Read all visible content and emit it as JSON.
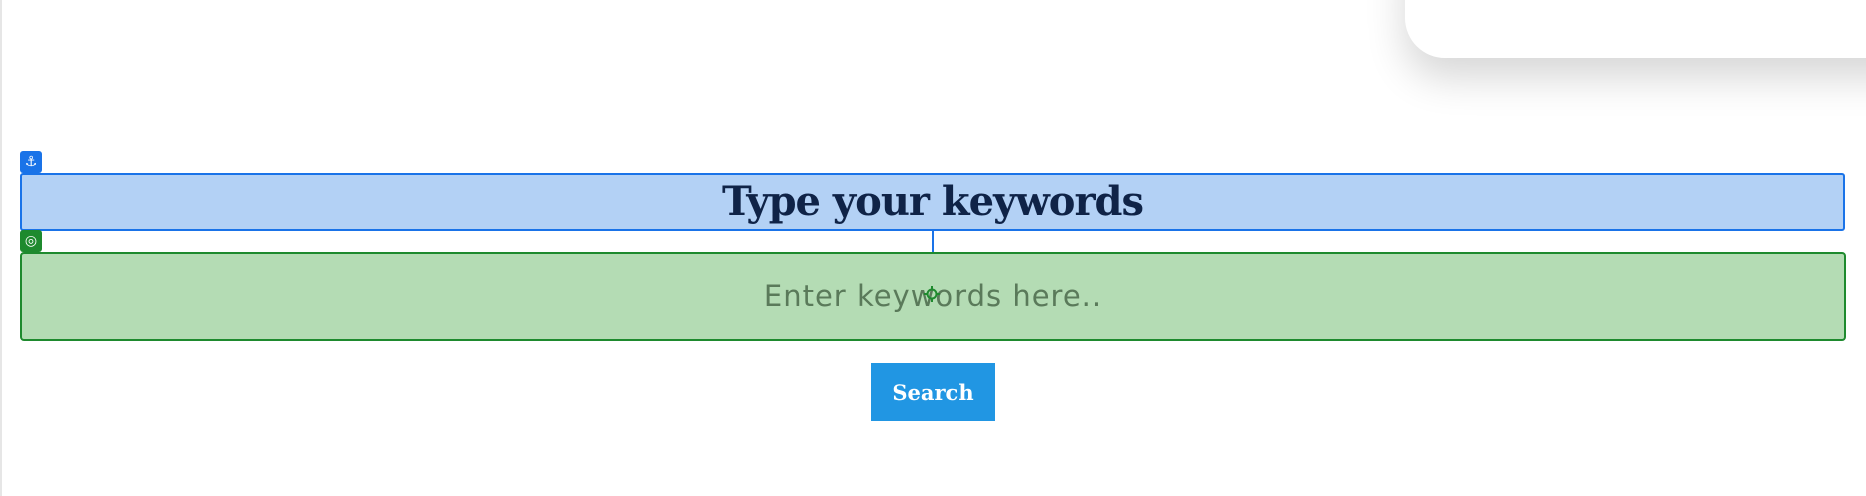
{
  "form": {
    "title": "Type your keywords",
    "keyword_input": {
      "placeholder": "Enter keywords here..",
      "value": ""
    },
    "search_button_label": "Search"
  },
  "editor_overlay": {
    "title_block_icon": "anchor-icon",
    "input_block_icon": "target-icon",
    "title_block_color": "#1a73e8",
    "input_block_color": "#1e8a2e"
  },
  "colors": {
    "title_text": "#0f2347",
    "button_background": "#2196e3"
  }
}
